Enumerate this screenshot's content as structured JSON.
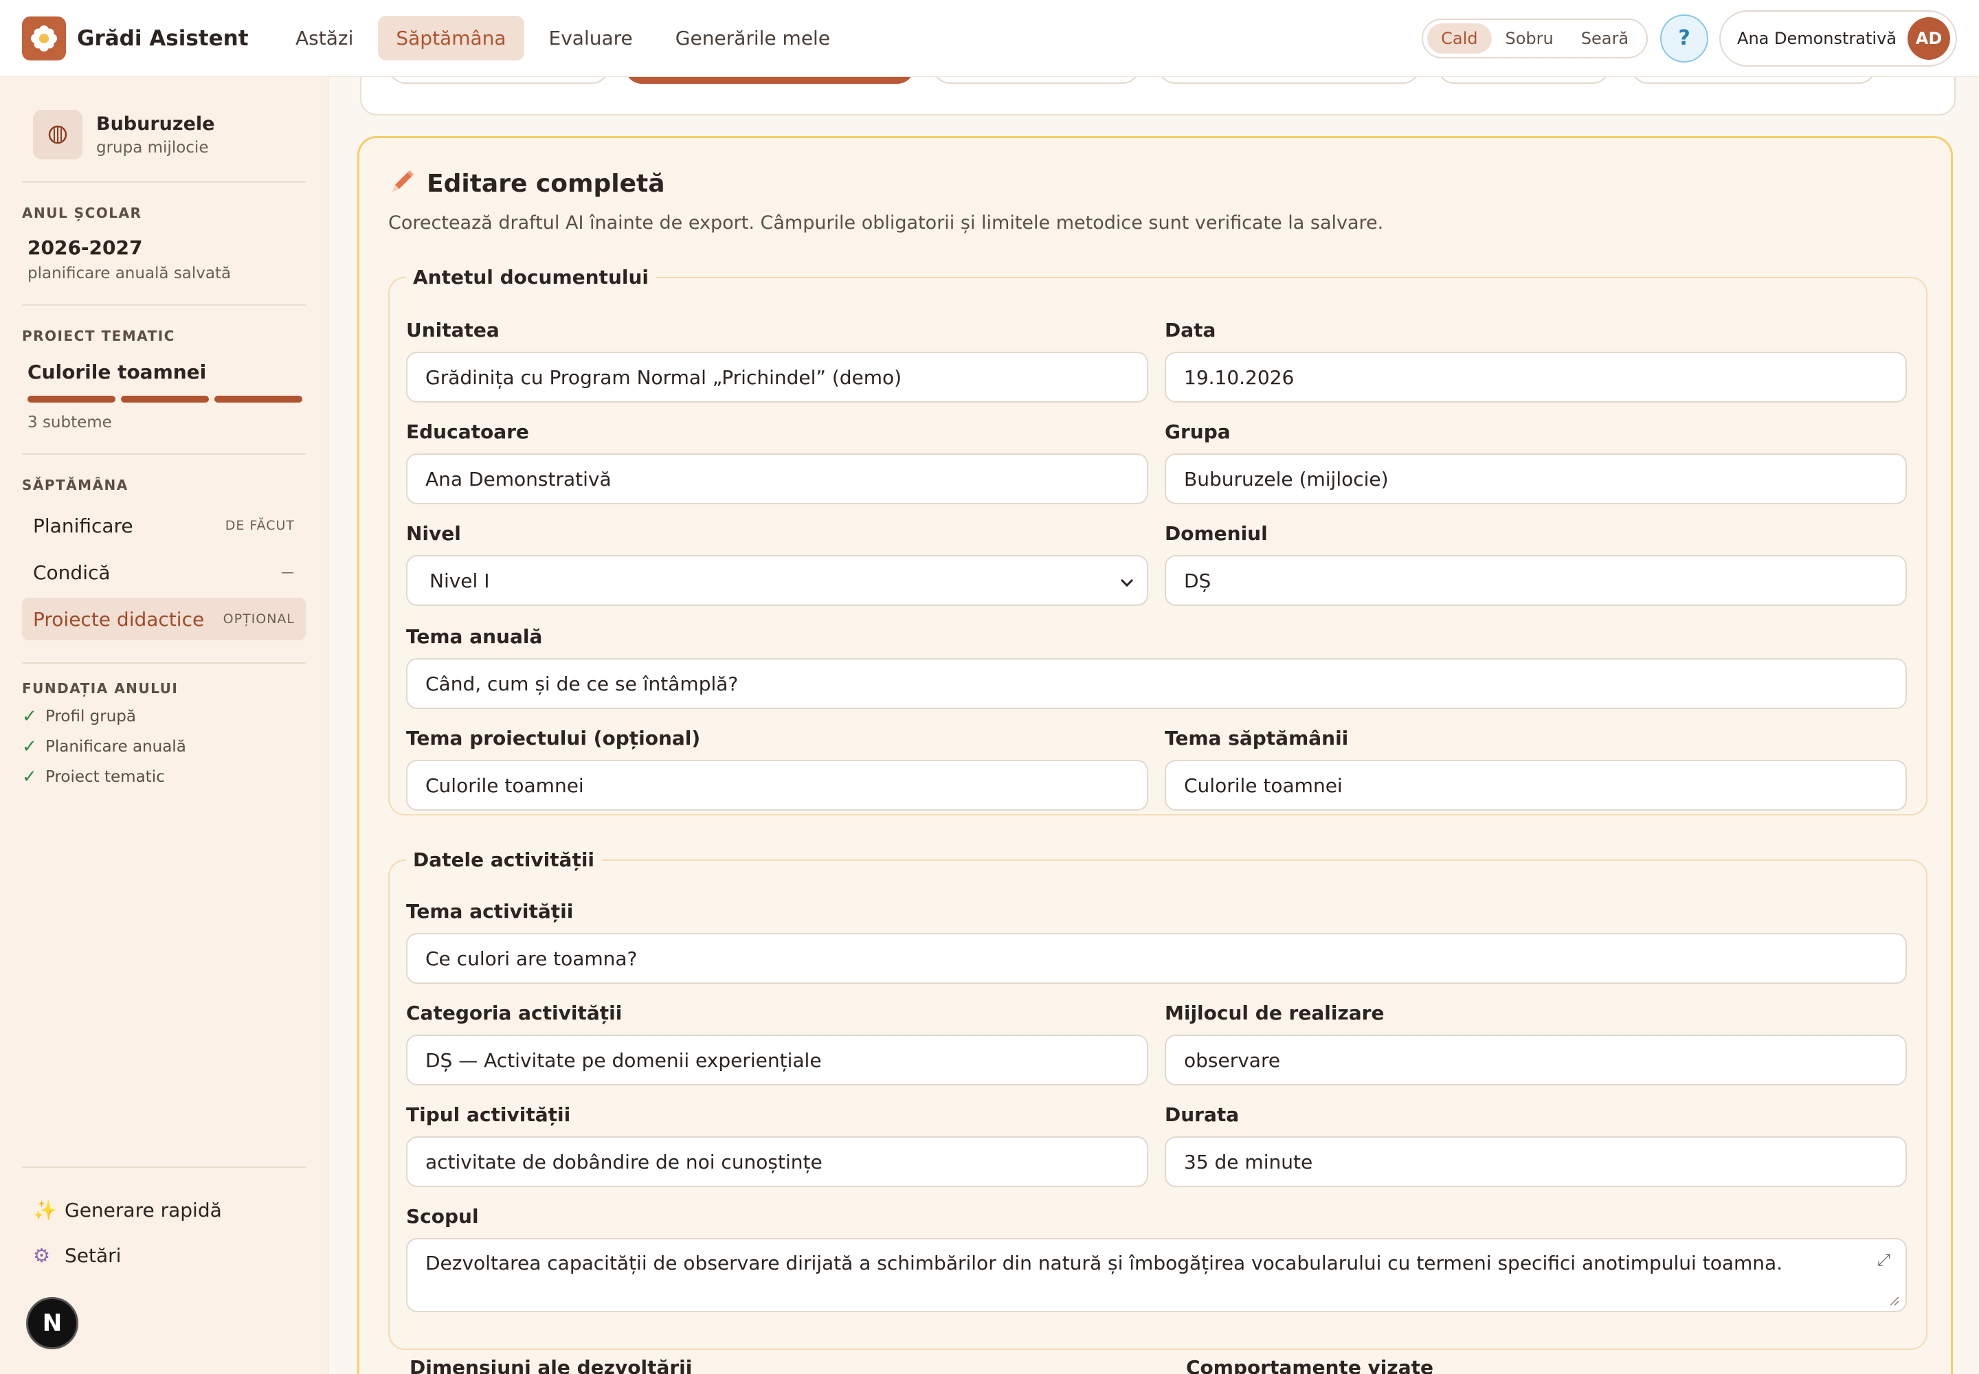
{
  "app": {
    "name": "Grădi Asistent"
  },
  "nav": {
    "items": [
      {
        "label": "Astăzi",
        "active": false
      },
      {
        "label": "Săptămâna",
        "active": true
      },
      {
        "label": "Evaluare",
        "active": false
      },
      {
        "label": "Generările mele",
        "active": false
      }
    ]
  },
  "tone": {
    "options": [
      "Cald",
      "Sobru",
      "Seară"
    ],
    "selected": "Cald"
  },
  "help": {
    "label": "?"
  },
  "user": {
    "name": "Ana Demonstrativă",
    "initials": "AD"
  },
  "sidebar": {
    "group": {
      "name": "Buburuzele",
      "level": "grupa mijlocie"
    },
    "school_year": {
      "label": "ANUL ȘCOLAR",
      "value": "2026-2027",
      "note": "planificare anuală salvată"
    },
    "project": {
      "label": "PROIECT TEMATIC",
      "title": "Culorile toamnei",
      "subthemes": "3 subteme",
      "segments": 3
    },
    "week": {
      "label": "SĂPTĂMÂNA",
      "items": [
        {
          "label": "Planificare",
          "badge": "DE FĂCUT",
          "active": false
        },
        {
          "label": "Condică",
          "badge": "—",
          "active": false
        },
        {
          "label": "Proiecte didactice",
          "badge": "OPȚIONAL",
          "active": true
        }
      ]
    },
    "foundation": {
      "label": "FUNDAȚIA ANULUI",
      "items": [
        "Profil grupă",
        "Planificare anuală",
        "Proiect tematic"
      ]
    },
    "actions": {
      "quick": "Generare rapidă",
      "settings": "Setări"
    },
    "badge": "N"
  },
  "editor": {
    "title": "Editare completă",
    "description": "Corectează draftul AI înainte de export. Câmpurile obligatorii și limitele metodice sunt verificate la salvare.",
    "header_section": {
      "legend": "Antetul documentului",
      "unit": {
        "label": "Unitatea",
        "value": "Grădinița cu Program Normal „Prichindel” (demo)"
      },
      "date": {
        "label": "Data",
        "value": "19.10.2026"
      },
      "teacher": {
        "label": "Educatoare",
        "value": "Ana Demonstrativă"
      },
      "group": {
        "label": "Grupa",
        "value": "Buburuzele (mijlocie)"
      },
      "level": {
        "label": "Nivel",
        "value": "Nivel I"
      },
      "domain": {
        "label": "Domeniul",
        "value": "DȘ"
      },
      "annual_theme": {
        "label": "Tema anuală",
        "value": "Când, cum și de ce se întâmplă?"
      },
      "project_theme": {
        "label": "Tema proiectului (opțional)",
        "value": "Culorile toamnei"
      },
      "week_theme": {
        "label": "Tema săptămânii",
        "value": "Culorile toamnei"
      }
    },
    "activity_section": {
      "legend": "Datele activității",
      "theme": {
        "label": "Tema activității",
        "value": "Ce culori are toamna?"
      },
      "category": {
        "label": "Categoria activității",
        "value": "DȘ — Activitate pe domenii experiențiale"
      },
      "means": {
        "label": "Mijlocul de realizare",
        "value": "observare"
      },
      "type": {
        "label": "Tipul activității",
        "value": "activitate de dobândire de noi cunoștințe"
      },
      "duration": {
        "label": "Durata",
        "value": "35 de minute"
      },
      "goal": {
        "label": "Scopul",
        "value": "Dezvoltarea capacității de observare dirijată a schimbărilor din natură și îmbogățirea vocabularului cu termeni specifici anotimpului toamna."
      }
    },
    "next_labels": {
      "dimensions": "Dimensiuni ale dezvoltării",
      "behaviours": "Comportamente vizate"
    }
  },
  "colors": {
    "accent": "#b05330",
    "brand": "#c0623a",
    "highlight_border": "#f3cf6a",
    "check": "#2f8a4a"
  }
}
